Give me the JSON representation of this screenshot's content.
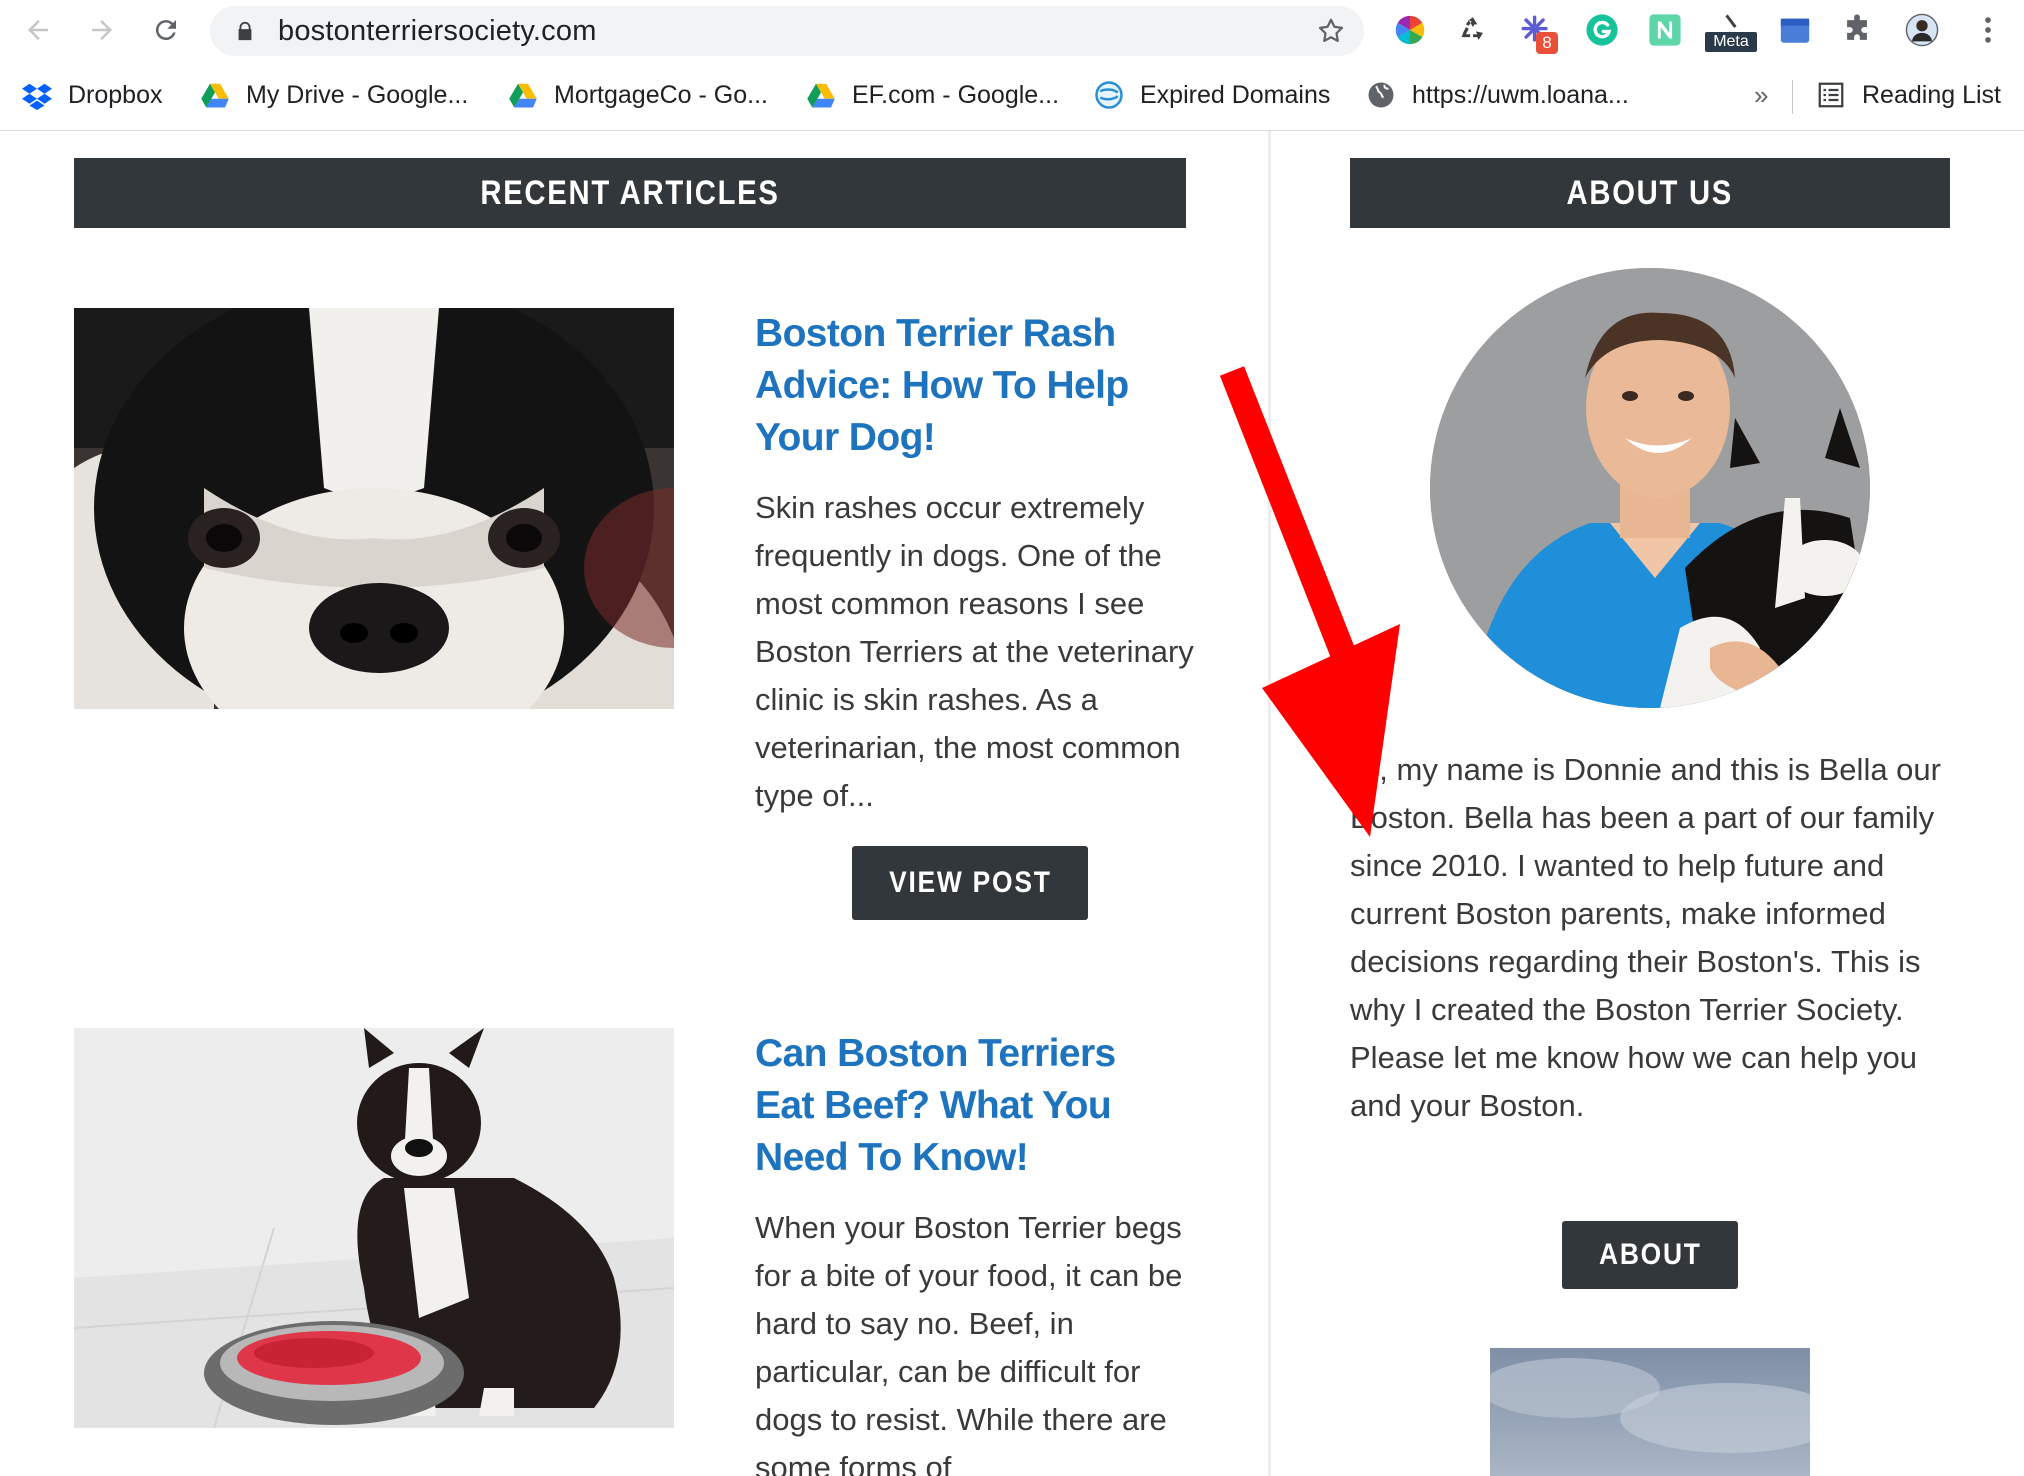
{
  "browser": {
    "url": "bostonterriersociety.com",
    "extension_badge": "8",
    "meta_label": "Meta",
    "bookmarks": [
      {
        "label": "Dropbox",
        "icon": "dropbox-icon"
      },
      {
        "label": "My Drive - Google...",
        "icon": "google-drive-icon"
      },
      {
        "label": "MortgageCo - Go...",
        "icon": "google-drive-icon"
      },
      {
        "label": "EF.com - Google...",
        "icon": "google-drive-icon"
      },
      {
        "label": "Expired Domains",
        "icon": "globe-blue-icon"
      },
      {
        "label": "https://uwm.loana...",
        "icon": "globe-icon"
      }
    ],
    "overflow_label": "»",
    "reading_list_label": "Reading List"
  },
  "recent": {
    "heading": "RECENT ARTICLES",
    "articles": [
      {
        "title": "Boston Terrier Rash Advice: How To Help Your Dog!",
        "excerpt": "Skin rashes occur extremely frequently in dogs. One of the most common reasons I see Boston Terriers at the veterinary clinic is skin rashes.  As a veterinarian, the most common type of...",
        "button": "VIEW POST"
      },
      {
        "title": "Can Boston Terriers Eat Beef? What You Need To Know!",
        "excerpt": "When your Boston Terrier begs for a bite of your food, it can be hard to say no. Beef, in particular, can be difficult for dogs to resist. While there are some forms of"
      }
    ]
  },
  "about": {
    "heading": "ABOUT US",
    "text": "Hi, my name is Donnie and this is Bella our Boston. Bella has been a part of our family since 2010. I wanted to help future and current Boston parents, make informed decisions regarding their Boston's. This is why I created the Boston Terrier Society. Please let me know how we can help you and your Boston.",
    "button": "ABOUT"
  },
  "colors": {
    "widget_bg": "#32373c",
    "link": "#1e73be",
    "body_text": "#3a3a3a",
    "annotation_arrow": "#ff0000"
  }
}
